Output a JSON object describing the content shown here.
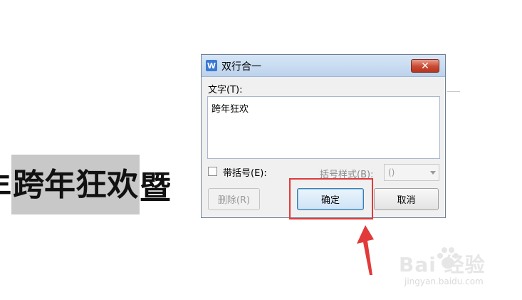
{
  "document": {
    "text_before": "年",
    "selected_text": "跨年狂欢",
    "text_after": "暨"
  },
  "dialog": {
    "app_icon_letter": "W",
    "title": "双行合一",
    "close_glyph": "✕",
    "text_label": "文字(T):",
    "text_value": "跨年狂欢",
    "bracket_checkbox": {
      "label": "带括号(E):",
      "checked": false
    },
    "bracket_style": {
      "label": "括号样式(B):",
      "value": "()",
      "enabled": false
    },
    "buttons": {
      "delete": "删除(R)",
      "ok": "确定",
      "cancel": "取消"
    }
  },
  "annotation": {
    "highlight_color": "#e23a3a"
  },
  "watermark": {
    "brand": "Bai  经验",
    "site": "jingyan.baidu.com"
  }
}
